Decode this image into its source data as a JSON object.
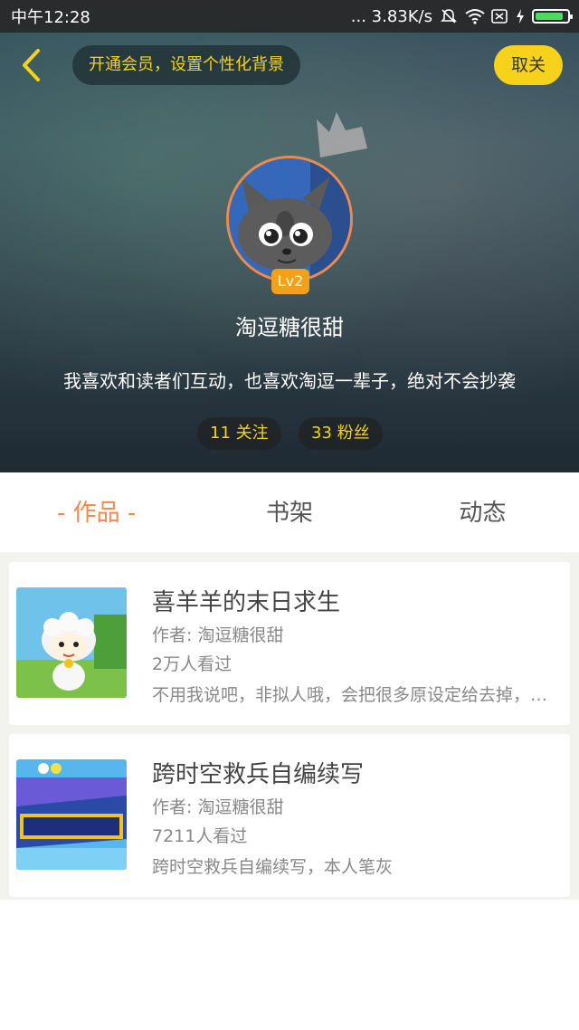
{
  "status_bar": {
    "time": "中午12:28",
    "network_speed": "... 3.83K/s",
    "icons": [
      "mute-icon",
      "wifi-icon",
      "sim-off-icon",
      "charging-icon",
      "battery-icon"
    ]
  },
  "header": {
    "vip_prompt": "开通会员，设置个性化背景",
    "cancel_label": "取关"
  },
  "profile": {
    "level": "Lv2",
    "nickname": "淘逗糖很甜",
    "bio": "我喜欢和读者们互动，也喜欢淘逗一辈子，绝对不会抄袭",
    "following": "11 关注",
    "fans": "33 粉丝"
  },
  "tabs": [
    {
      "label": "- 作品 -",
      "active": true
    },
    {
      "label": "书架",
      "active": false
    },
    {
      "label": "动态",
      "active": false
    }
  ],
  "works": [
    {
      "title": "喜羊羊的末日求生",
      "author": "作者: 淘逗糖很甜",
      "views": "2万人看过",
      "description": "不用我说吧，非拟人哦，会把很多原设定给去掉，所以不用担心"
    },
    {
      "title": "跨时空救兵自编续写",
      "author": "作者: 淘逗糖很甜",
      "views": "7211人看过",
      "description": "跨时空救兵自编续写，本人笔灰"
    }
  ],
  "colors": {
    "accent": "#f08a4b",
    "highlight_yellow": "#f5d31a",
    "cancel_button": "#f7d21b",
    "level_badge": "#f2a11a"
  }
}
